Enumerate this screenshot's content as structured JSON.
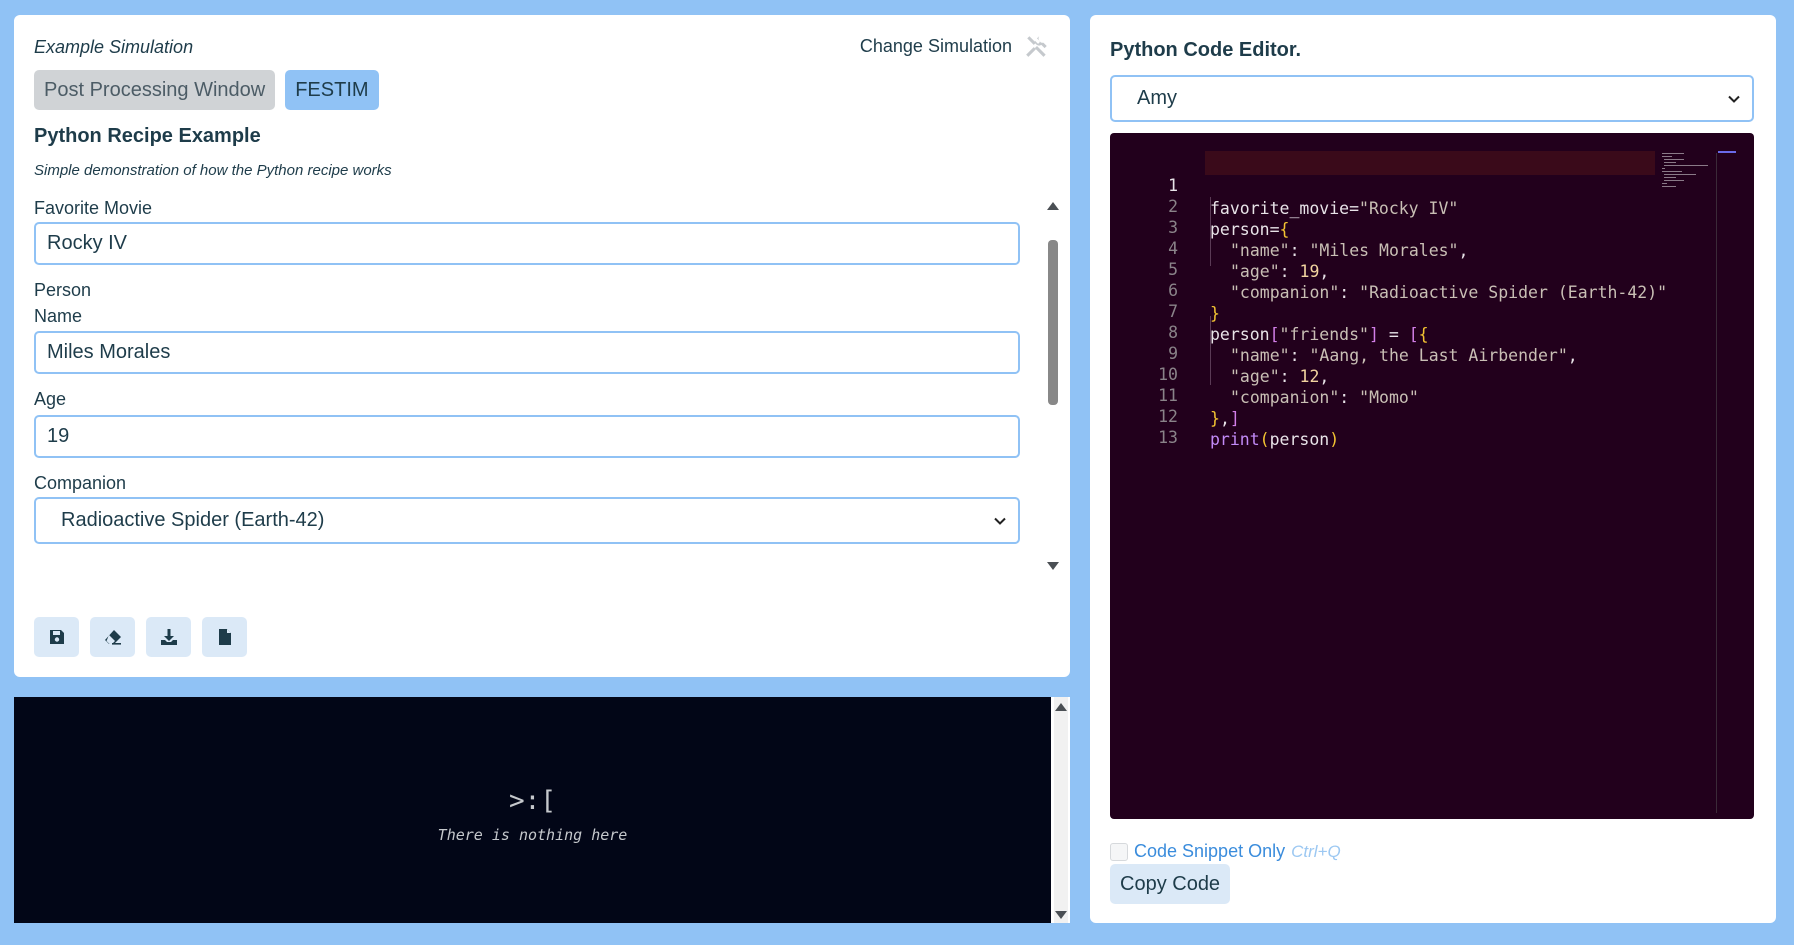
{
  "sim_panel": {
    "simulation_name": "Example Simulation",
    "change_simulation_label": "Change Simulation",
    "tabs": [
      {
        "label": "Post Processing Window"
      },
      {
        "label": "FESTIM"
      }
    ],
    "recipe_title": "Python Recipe Example",
    "recipe_description": "Simple demonstration of how the Python recipe works",
    "form": {
      "favorite_movie_label": "Favorite Movie",
      "favorite_movie_value": "Rocky IV",
      "person_label": "Person",
      "name_label": "Name",
      "name_value": "Miles Morales",
      "age_label": "Age",
      "age_value": "19",
      "companion_label": "Companion",
      "companion_value": "Radioactive Spider (Earth-42)"
    },
    "toolbar_icons": [
      "save-icon",
      "eraser-icon",
      "download-icon",
      "file-icon"
    ]
  },
  "console": {
    "face": ">:[",
    "message": "There is nothing here"
  },
  "editor_panel": {
    "title": "Python Code Editor.",
    "theme_selected": "Amy",
    "code_lines": [
      {
        "n": "1"
      },
      {
        "n": "2"
      },
      {
        "n": "3"
      },
      {
        "n": "4"
      },
      {
        "n": "5"
      },
      {
        "n": "6"
      },
      {
        "n": "7"
      },
      {
        "n": "8"
      },
      {
        "n": "9"
      },
      {
        "n": "10"
      },
      {
        "n": "11"
      },
      {
        "n": "12"
      },
      {
        "n": "13"
      }
    ],
    "code": {
      "l1_var": "favorite_movie",
      "l1_eq": "=",
      "l1_str": "\"Rocky IV\"",
      "l2_var": "person",
      "l2_eq": "=",
      "l2_brace": "{",
      "l3_key": "\"name\"",
      "l3_colon": ": ",
      "l3_val": "\"Miles Morales\"",
      "l3_comma": ",",
      "l4_key": "\"age\"",
      "l4_colon": ": ",
      "l4_val": "19",
      "l4_comma": ",",
      "l5_key": "\"companion\"",
      "l5_colon": ": ",
      "l5_val": "\"Radioactive Spider (Earth-42)\"",
      "l6_brace": "}",
      "l7_var": "person",
      "l7_brk": "[",
      "l7_key": "\"friends\"",
      "l7_brk2": "]",
      "l7_eq": " = ",
      "l7_brk3": "[",
      "l7_brace": "{",
      "l8_key": "\"name\"",
      "l8_colon": ": ",
      "l8_val": "\"Aang, the Last Airbender\"",
      "l8_comma": ",",
      "l9_key": "\"age\"",
      "l9_colon": ": ",
      "l9_val": "12",
      "l9_comma": ",",
      "l10_key": "\"companion\"",
      "l10_colon": ": ",
      "l10_val": "\"Momo\"",
      "l11_brace": "}",
      "l11_comma": ",",
      "l11_brk": "]",
      "l12_fn": "print",
      "l12_open": "(",
      "l12_arg": "person",
      "l12_close": ")"
    },
    "snippet_only_label": "Code Snippet Only",
    "snippet_shortcut": "Ctrl+Q",
    "snippet_checked": false,
    "copy_button_label": "Copy Code"
  },
  "colors": {
    "page_background": "#90c2f5",
    "editor_background": "#22001c",
    "console_background": "#020617",
    "accent": "#90c2f5"
  }
}
